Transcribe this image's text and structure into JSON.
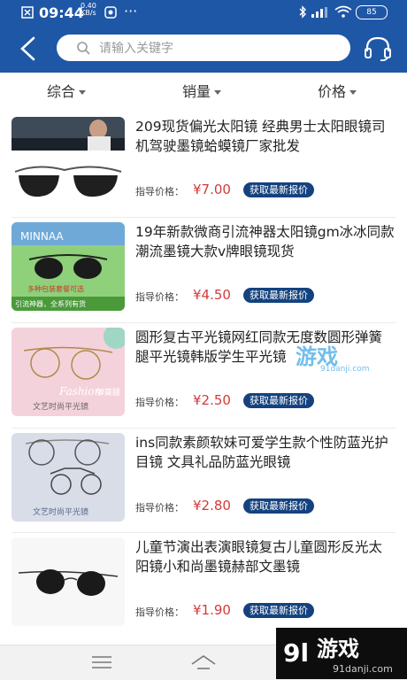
{
  "status_bar": {
    "time": "09:44",
    "speed_value": "0.40",
    "speed_unit": "KB/s",
    "more": "···",
    "battery": "85"
  },
  "header": {
    "search_placeholder": "请输入关键字"
  },
  "sort_tabs": [
    {
      "label": "综合"
    },
    {
      "label": "销量"
    },
    {
      "label": "价格"
    }
  ],
  "products": [
    {
      "title": "209现货偏光太阳镜 经典男士太阳眼镜司机驾驶墨镜蛤蟆镜厂家批发",
      "price_label": "指导价格：",
      "price": "¥7.00",
      "quote_button": "获取最新报价"
    },
    {
      "title": "19年新款微商引流神器太阳镜gm冰冰同款潮流墨镜大款v牌眼镜现货",
      "price_label": "指导价格：",
      "price": "¥4.50",
      "quote_button": "获取最新报价",
      "thumb_brand": "MINNAA",
      "thumb_text1": "多种包装套餐可选",
      "thumb_text2": "引流神器，全系列有货"
    },
    {
      "title": "圆形复古平光镜网红同款无度数圆形弹簧腿平光镜韩版学生平光镜",
      "price_label": "指导价格：",
      "price": "¥2.50",
      "quote_button": "获取最新报价",
      "thumb_script": "Fashion",
      "thumb_tag": "弹簧腿",
      "thumb_caption": "文艺时尚平光镜"
    },
    {
      "title": "ins同款素颜软妹可爱学生款个性防蓝光护目镜 文具礼品防蓝光眼镜",
      "price_label": "指导价格：",
      "price": "¥2.80",
      "quote_button": "获取最新报价",
      "thumb_caption": "文艺时尚平光镜"
    },
    {
      "title": "儿童节演出表演眼镜复古儿童圆形反光太阳镜小和尚墨镜赫部文墨镜",
      "price_label": "指导价格：",
      "price": "¥1.90",
      "quote_button": "获取最新报价"
    }
  ],
  "watermark": {
    "brand": "游戏",
    "site": "91danji.com",
    "mid_brand": "游戏",
    "mid_site": "91danji.com"
  },
  "icons": [
    "back-arrow-icon",
    "search-icon",
    "headset-icon",
    "menu-icon",
    "home-icon",
    "bluetooth-icon",
    "wifi-icon"
  ],
  "colors": {
    "header": "#1f57a7",
    "price": "#d43a3a",
    "quote_button": "#14427f"
  }
}
